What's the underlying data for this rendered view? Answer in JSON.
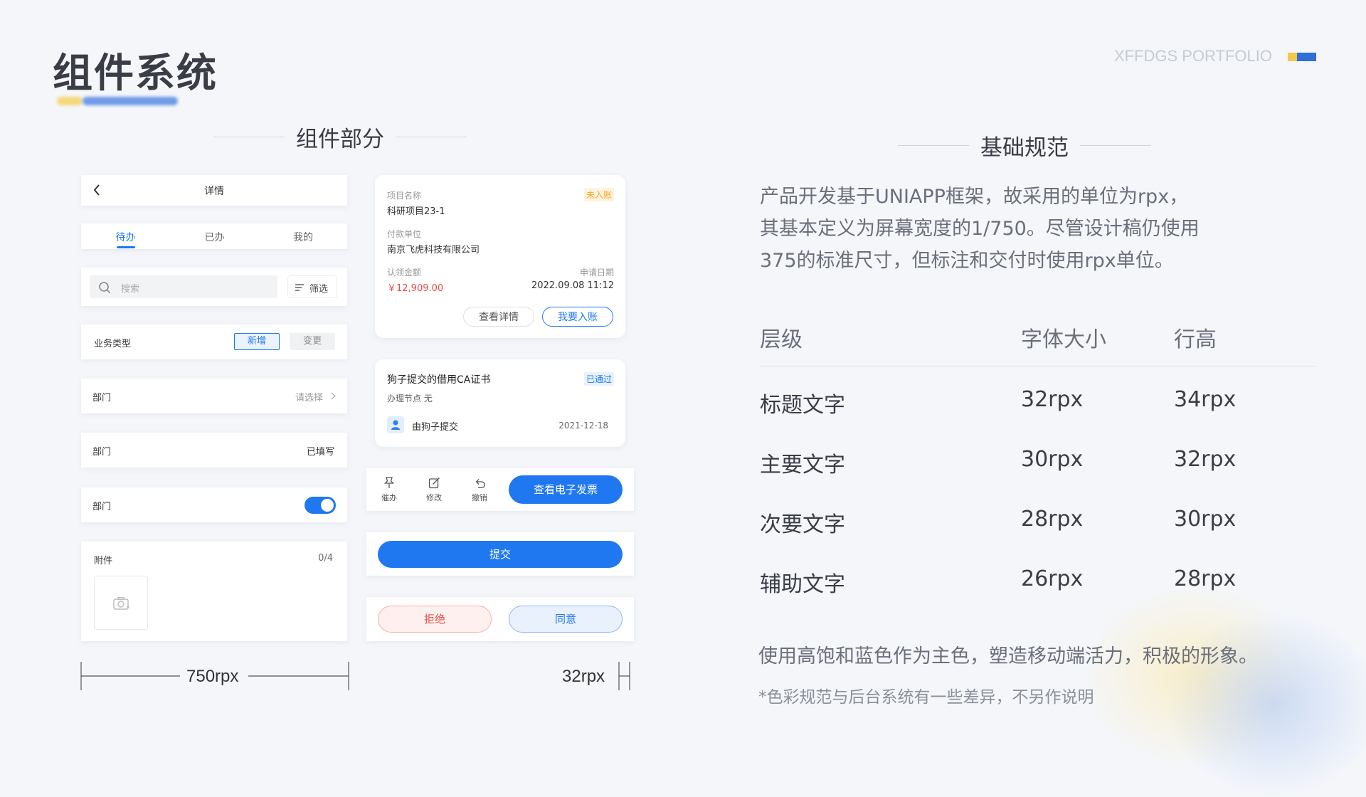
{
  "header": {
    "title": "组件系统",
    "brand": "XFFDGS PORTFOLIO",
    "brand_colors": [
      "#f3c84b",
      "#2e6fd8"
    ]
  },
  "components_section": {
    "title": "组件部分"
  },
  "nav_card": {
    "title": "详情"
  },
  "tabs": {
    "items": [
      "待办",
      "已办",
      "我的"
    ],
    "active": "待办",
    "accent": "#1f78f0"
  },
  "search": {
    "placeholder": "搜索",
    "filter_label": "筛选"
  },
  "business_type": {
    "label": "业务类型",
    "options": [
      "新增",
      "变更"
    ],
    "selected": "新增"
  },
  "dept_select": {
    "label": "部门",
    "value": "请选择"
  },
  "dept_filled": {
    "label": "部门",
    "value": "已填写"
  },
  "dept_toggle": {
    "label": "部门",
    "on": true
  },
  "attachment": {
    "label": "附件",
    "count": "0/4"
  },
  "dim_750": "750rpx",
  "dim_32": "32rpx",
  "project_card": {
    "status": "未入账",
    "project_name_label": "项目名称",
    "project_name": "科研项目23-1",
    "payer_label": "付款单位",
    "payer": "南京飞虎科技有限公司",
    "amount_label": "认领金额",
    "amount": "￥12,909.00",
    "date_label": "申请日期",
    "date": "2022.09.08 11:12",
    "detail_button": "查看详情",
    "account_button": "我要入账"
  },
  "cert_card": {
    "title": "狗子提交的借用CA证书",
    "status": "已通过",
    "node": "办理节点 无",
    "submitter": "由狗子提交",
    "date": "2021-12-18"
  },
  "action_bar": {
    "actions": [
      "催办",
      "修改",
      "撤销"
    ],
    "primary": "查看电子发票"
  },
  "submit_button": "提交",
  "decision": {
    "reject": "拒绝",
    "agree": "同意"
  },
  "spec_section": {
    "title": "基础规范",
    "paragraph": [
      "产品开发基于UNIAPP框架，故采用的单位为rpx，",
      "其基本定义为屏幕宽度的1/750。尽管设计稿仍使用",
      "375的标准尺寸，但标注和交付时使用rpx单位。"
    ],
    "table": {
      "headers": [
        "层级",
        "字体大小",
        "行高"
      ],
      "rows": [
        [
          "标题文字",
          "32rpx",
          "34rpx"
        ],
        [
          "主要文字",
          "30rpx",
          "32rpx"
        ],
        [
          "次要文字",
          "28rpx",
          "30rpx"
        ],
        [
          "辅助文字",
          "26rpx",
          "28rpx"
        ]
      ]
    },
    "color_note": "使用高饱和蓝色作为主色，塑造移动端活力，积极的形象。",
    "footnote": "*色彩规范与后台系统有一些差异，不另作说明"
  }
}
